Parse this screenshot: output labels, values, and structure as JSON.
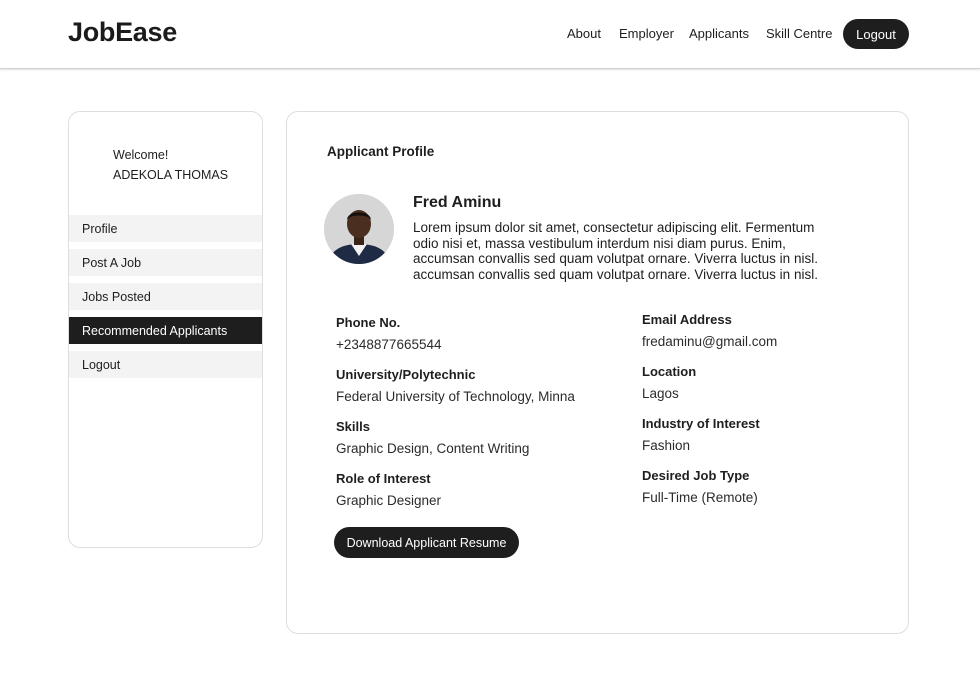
{
  "header": {
    "logo": "JobEase",
    "nav": [
      "About",
      "Employer",
      "Applicants",
      "Skill Centre"
    ],
    "logout": "Logout"
  },
  "sidebar": {
    "welcome": "Welcome!",
    "user_name": "ADEKOLA THOMAS",
    "items": [
      {
        "label": "Profile"
      },
      {
        "label": "Post A Job"
      },
      {
        "label": "Jobs Posted"
      },
      {
        "label": "Recommended Applicants",
        "active": true
      },
      {
        "label": "Logout"
      }
    ]
  },
  "profile": {
    "title": "Applicant Profile",
    "name": "Fred Aminu",
    "bio": "Lorem ipsum dolor sit amet, consectetur adipiscing elit. Fermentum odio nisi et, massa vestibulum interdum nisi diam purus. Enim, accumsan convallis sed quam volutpat ornare. Viverra luctus in nisl. accumsan convallis sed quam volutpat ornare. Viverra luctus in nisl.",
    "left_fields": [
      {
        "label": "Phone No.",
        "value": "+2348877665544"
      },
      {
        "label": "University/Polytechnic",
        "value": "Federal University of Technology, Minna"
      },
      {
        "label": "Skills",
        "value": "Graphic Design, Content Writing"
      },
      {
        "label": "Role of Interest",
        "value": "Graphic Designer"
      }
    ],
    "right_fields": [
      {
        "label": "Email Address",
        "value": "fredaminu@gmail.com"
      },
      {
        "label": "Location",
        "value": "Lagos"
      },
      {
        "label": "Industry of Interest",
        "value": "Fashion"
      },
      {
        "label": "Desired Job Type",
        "value": "Full-Time (Remote)"
      }
    ],
    "download_button": "Download Applicant Resume"
  },
  "colors": {
    "primary_dark": "#1e1e1e",
    "sidebar_item_bg": "#f3f3f3",
    "border": "#dedede"
  }
}
